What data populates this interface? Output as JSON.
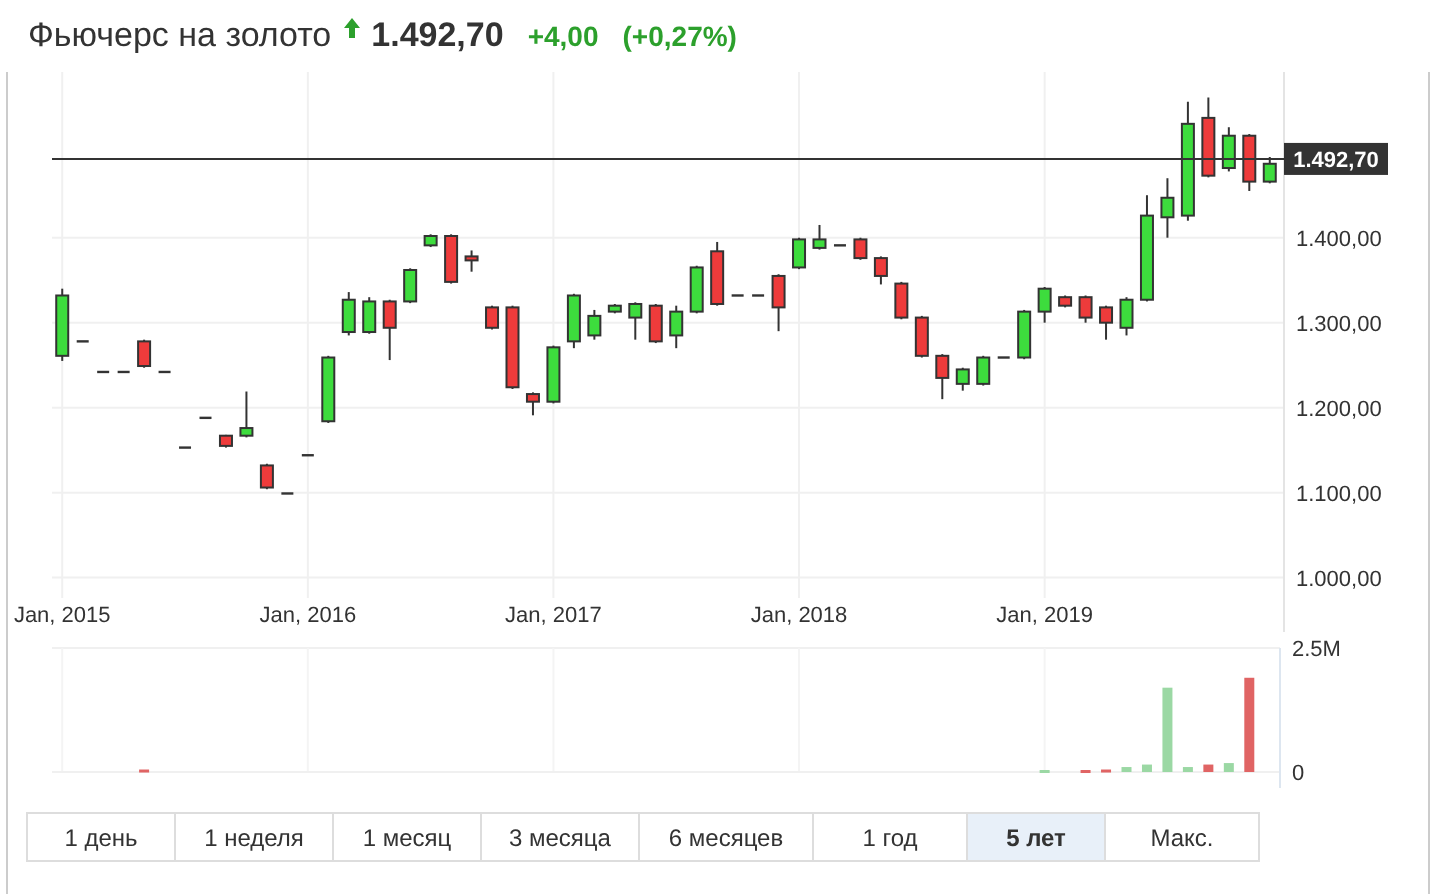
{
  "header": {
    "title": "Фьючерс на золото",
    "rising": true,
    "price": "1.492,70",
    "change": "+4,00",
    "change_percent": "(+0,27%)"
  },
  "price_chart": {
    "chart_data": {
      "type": "candlestick",
      "categories": [
        "Jan, 2015",
        null,
        null,
        null,
        null,
        null,
        null,
        null,
        null,
        null,
        null,
        null,
        "Jan, 2016",
        null,
        null,
        null,
        null,
        null,
        null,
        null,
        null,
        null,
        null,
        null,
        "Jan, 2017",
        null,
        null,
        null,
        null,
        null,
        null,
        null,
        null,
        null,
        null,
        null,
        "Jan, 2018",
        null,
        null,
        null,
        null,
        null,
        null,
        null,
        null,
        null,
        null,
        null,
        "Jan, 2019",
        null,
        null,
        null,
        null,
        null,
        null,
        null,
        null,
        null,
        null,
        null
      ],
      "ohlc": [
        [
          1261,
          1340,
          1255,
          1332
        ],
        [
          1278,
          1278,
          1278,
          1278
        ],
        [
          1242,
          1242,
          1242,
          1242
        ],
        [
          1242,
          1242,
          1242,
          1242
        ],
        [
          1278,
          1280,
          1247,
          1249
        ],
        [
          1242,
          1242,
          1242,
          1242
        ],
        [
          1153,
          1153,
          1153,
          1153
        ],
        [
          1188,
          1188,
          1188,
          1188
        ],
        [
          1167,
          1168,
          1153,
          1155
        ],
        [
          1167,
          1219,
          1165,
          1176
        ],
        [
          1132,
          1134,
          1104,
          1106
        ],
        [
          1099,
          1099,
          1099,
          1099
        ],
        [
          1144,
          1144,
          1144,
          1144
        ],
        [
          1184,
          1261,
          1182,
          1259
        ],
        [
          1289,
          1336,
          1285,
          1327
        ],
        [
          1289,
          1330,
          1287,
          1325
        ],
        [
          1325,
          1327,
          1256,
          1294
        ],
        [
          1325,
          1364,
          1323,
          1362
        ],
        [
          1391,
          1404,
          1389,
          1402
        ],
        [
          1402,
          1404,
          1346,
          1348
        ],
        [
          1378,
          1385,
          1360,
          1374
        ],
        [
          1318,
          1320,
          1292,
          1294
        ],
        [
          1318,
          1320,
          1222,
          1224
        ],
        [
          1216,
          1218,
          1191,
          1207
        ],
        [
          1207,
          1273,
          1205,
          1271
        ],
        [
          1278,
          1334,
          1270,
          1332
        ],
        [
          1285,
          1315,
          1280,
          1308
        ],
        [
          1313,
          1322,
          1311,
          1320
        ],
        [
          1306,
          1324,
          1280,
          1322
        ],
        [
          1320,
          1322,
          1276,
          1278
        ],
        [
          1285,
          1320,
          1270,
          1313
        ],
        [
          1313,
          1367,
          1311,
          1365
        ],
        [
          1384,
          1395,
          1320,
          1322
        ],
        [
          1332,
          1332,
          1332,
          1332
        ],
        [
          1332,
          1332,
          1332,
          1332
        ],
        [
          1355,
          1357,
          1290,
          1318
        ],
        [
          1365,
          1400,
          1363,
          1398
        ],
        [
          1388,
          1415,
          1386,
          1398
        ],
        [
          1391,
          1391,
          1391,
          1391
        ],
        [
          1398,
          1400,
          1374,
          1376
        ],
        [
          1376,
          1378,
          1345,
          1355
        ],
        [
          1346,
          1348,
          1304,
          1306
        ],
        [
          1306,
          1308,
          1259,
          1261
        ],
        [
          1261,
          1263,
          1210,
          1235
        ],
        [
          1228,
          1247,
          1220,
          1245
        ],
        [
          1228,
          1261,
          1226,
          1259
        ],
        [
          1259,
          1259,
          1259,
          1259
        ],
        [
          1259,
          1315,
          1257,
          1313
        ],
        [
          1313,
          1342,
          1300,
          1340
        ],
        [
          1330,
          1332,
          1318,
          1320
        ],
        [
          1330,
          1332,
          1300,
          1306
        ],
        [
          1318,
          1320,
          1280,
          1300
        ],
        [
          1294,
          1330,
          1285,
          1327
        ],
        [
          1327,
          1450,
          1325,
          1426
        ],
        [
          1424,
          1470,
          1400,
          1447
        ],
        [
          1426,
          1560,
          1420,
          1534
        ],
        [
          1541,
          1565,
          1471,
          1473
        ],
        [
          1482,
          1530,
          1478,
          1520
        ],
        [
          1520,
          1522,
          1455,
          1466
        ],
        [
          1466,
          1495,
          1464,
          1487
        ]
      ],
      "ylim": [
        976,
        1595
      ],
      "yticks": [
        {
          "value": 1000,
          "label": "1.000,00"
        },
        {
          "value": 1100,
          "label": "1.100,00"
        },
        {
          "value": 1200,
          "label": "1.200,00"
        },
        {
          "value": 1300,
          "label": "1.300,00"
        },
        {
          "value": 1400,
          "label": "1.400,00"
        }
      ],
      "grid": true,
      "ref_lines": [
        {
          "axis": "y",
          "value": 1492.7,
          "label": "1.492,70"
        }
      ]
    }
  },
  "volume_chart": {
    "chart_data": {
      "type": "bar",
      "grid": true,
      "values": [
        null,
        null,
        null,
        null,
        0.05,
        null,
        null,
        null,
        null,
        null,
        null,
        null,
        null,
        null,
        null,
        null,
        null,
        null,
        null,
        null,
        null,
        null,
        null,
        null,
        null,
        null,
        null,
        null,
        null,
        null,
        null,
        null,
        null,
        null,
        null,
        null,
        null,
        null,
        null,
        null,
        null,
        null,
        null,
        null,
        null,
        null,
        null,
        null,
        0.04,
        null,
        0.04,
        0.05,
        0.1,
        0.15,
        1.7,
        0.1,
        0.15,
        0.18,
        1.9,
        null
      ],
      "ylim": [
        0,
        2.5
      ],
      "yticks": [
        {
          "value": 0,
          "label": "0"
        },
        {
          "value": 2.5,
          "label": "2.5M"
        }
      ]
    }
  },
  "periods": [
    {
      "label": "1 день",
      "selected": false
    },
    {
      "label": "1 неделя",
      "selected": false
    },
    {
      "label": "1 месяц",
      "selected": false
    },
    {
      "label": "3 месяца",
      "selected": false
    },
    {
      "label": "6 месяцев",
      "selected": false
    },
    {
      "label": "1 год",
      "selected": false
    },
    {
      "label": "5 лет",
      "selected": true
    },
    {
      "label": "Макс.",
      "selected": false
    }
  ]
}
